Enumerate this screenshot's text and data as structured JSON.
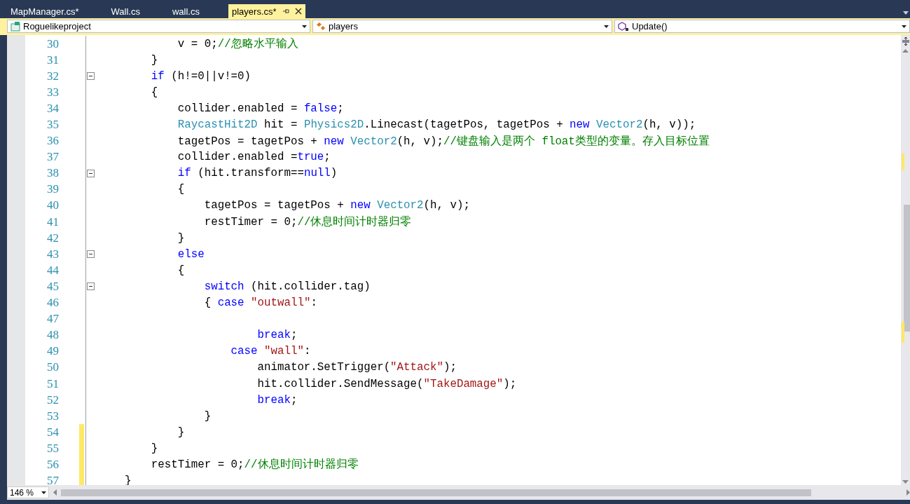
{
  "tabs": [
    {
      "label": "MapManager.cs*",
      "selected": false
    },
    {
      "label": "Wall.cs",
      "selected": false
    },
    {
      "label": "wall.cs",
      "selected": false
    },
    {
      "label": "players.cs*",
      "selected": true
    }
  ],
  "navigation_bar": {
    "project": "Roguelikeproject",
    "class": "players",
    "member": "Update()"
  },
  "code_lines": [
    {
      "number": "30",
      "collapsible": false,
      "modified": false,
      "tokens": [
        {
          "kind": "plain",
          "text": "            v = 0;"
        },
        {
          "kind": "comment",
          "text": "//忽略水平输入"
        }
      ]
    },
    {
      "number": "31",
      "collapsible": false,
      "modified": false,
      "tokens": [
        {
          "kind": "plain",
          "text": "        }"
        }
      ]
    },
    {
      "number": "32",
      "collapsible": true,
      "modified": false,
      "tokens": [
        {
          "kind": "keyword",
          "text": "        if"
        },
        {
          "kind": "plain",
          "text": " (h!=0||v!=0)"
        }
      ]
    },
    {
      "number": "33",
      "collapsible": false,
      "modified": false,
      "tokens": [
        {
          "kind": "plain",
          "text": "        {"
        }
      ]
    },
    {
      "number": "34",
      "collapsible": false,
      "modified": false,
      "tokens": [
        {
          "kind": "plain",
          "text": "            collider.enabled = "
        },
        {
          "kind": "keyword",
          "text": "false"
        },
        {
          "kind": "plain",
          "text": ";"
        }
      ]
    },
    {
      "number": "35",
      "collapsible": false,
      "modified": false,
      "tokens": [
        {
          "kind": "type",
          "text": "            RaycastHit2D"
        },
        {
          "kind": "plain",
          "text": " hit = "
        },
        {
          "kind": "type",
          "text": "Physics2D"
        },
        {
          "kind": "plain",
          "text": ".Linecast(tagetPos, tagetPos + "
        },
        {
          "kind": "keyword",
          "text": "new "
        },
        {
          "kind": "type",
          "text": "Vector2"
        },
        {
          "kind": "plain",
          "text": "(h, v));"
        }
      ]
    },
    {
      "number": "36",
      "collapsible": false,
      "modified": false,
      "tokens": [
        {
          "kind": "plain",
          "text": "            tagetPos = tagetPos + "
        },
        {
          "kind": "keyword",
          "text": "new "
        },
        {
          "kind": "type",
          "text": "Vector2"
        },
        {
          "kind": "plain",
          "text": "(h, v);"
        },
        {
          "kind": "comment",
          "text": "//键盘输入是两个 float类型的变量。存入目标位置"
        }
      ]
    },
    {
      "number": "37",
      "collapsible": false,
      "modified": false,
      "tokens": [
        {
          "kind": "plain",
          "text": "            collider.enabled ="
        },
        {
          "kind": "keyword",
          "text": "true"
        },
        {
          "kind": "plain",
          "text": ";"
        }
      ]
    },
    {
      "number": "38",
      "collapsible": true,
      "modified": false,
      "tokens": [
        {
          "kind": "keyword",
          "text": "            if"
        },
        {
          "kind": "plain",
          "text": " (hit.transform=="
        },
        {
          "kind": "keyword",
          "text": "null"
        },
        {
          "kind": "plain",
          "text": ")"
        }
      ]
    },
    {
      "number": "39",
      "collapsible": false,
      "modified": false,
      "tokens": [
        {
          "kind": "plain",
          "text": "            {"
        }
      ]
    },
    {
      "number": "40",
      "collapsible": false,
      "modified": false,
      "tokens": [
        {
          "kind": "plain",
          "text": "                tagetPos = tagetPos + "
        },
        {
          "kind": "keyword",
          "text": "new "
        },
        {
          "kind": "type",
          "text": "Vector2"
        },
        {
          "kind": "plain",
          "text": "(h, v);"
        }
      ]
    },
    {
      "number": "41",
      "collapsible": false,
      "modified": false,
      "tokens": [
        {
          "kind": "plain",
          "text": "                restTimer = 0;"
        },
        {
          "kind": "comment",
          "text": "//休息时间计时器归零"
        }
      ]
    },
    {
      "number": "42",
      "collapsible": false,
      "modified": false,
      "tokens": [
        {
          "kind": "plain",
          "text": "            }"
        }
      ]
    },
    {
      "number": "43",
      "collapsible": true,
      "modified": false,
      "tokens": [
        {
          "kind": "keyword",
          "text": "            else"
        }
      ]
    },
    {
      "number": "44",
      "collapsible": false,
      "modified": false,
      "tokens": [
        {
          "kind": "plain",
          "text": "            {"
        }
      ]
    },
    {
      "number": "45",
      "collapsible": true,
      "modified": false,
      "tokens": [
        {
          "kind": "keyword",
          "text": "                switch"
        },
        {
          "kind": "plain",
          "text": " (hit.collider.tag)"
        }
      ]
    },
    {
      "number": "46",
      "collapsible": false,
      "modified": false,
      "tokens": [
        {
          "kind": "plain",
          "text": "                { "
        },
        {
          "kind": "keyword",
          "text": "case "
        },
        {
          "kind": "string",
          "text": "\"outwall\""
        },
        {
          "kind": "plain",
          "text": ":"
        }
      ]
    },
    {
      "number": "47",
      "collapsible": false,
      "modified": false
    },
    {
      "number": "48",
      "collapsible": false,
      "modified": false,
      "tokens": [
        {
          "kind": "keyword",
          "text": "                        break"
        },
        {
          "kind": "plain",
          "text": ";"
        }
      ]
    },
    {
      "number": "49",
      "collapsible": false,
      "modified": false,
      "tokens": [
        {
          "kind": "keyword",
          "text": "                    case "
        },
        {
          "kind": "string",
          "text": "\"wall\""
        },
        {
          "kind": "plain",
          "text": ":"
        }
      ]
    },
    {
      "number": "50",
      "collapsible": false,
      "modified": false,
      "tokens": [
        {
          "kind": "plain",
          "text": "                        animator.SetTrigger("
        },
        {
          "kind": "string",
          "text": "\"Attack\""
        },
        {
          "kind": "plain",
          "text": ");"
        }
      ]
    },
    {
      "number": "51",
      "collapsible": false,
      "modified": false,
      "tokens": [
        {
          "kind": "plain",
          "text": "                        hit.collider.SendMessage("
        },
        {
          "kind": "string",
          "text": "\"TakeDamage\""
        },
        {
          "kind": "plain",
          "text": ");"
        }
      ]
    },
    {
      "number": "52",
      "collapsible": false,
      "modified": false,
      "tokens": [
        {
          "kind": "keyword",
          "text": "                        break"
        },
        {
          "kind": "plain",
          "text": ";"
        }
      ]
    },
    {
      "number": "53",
      "collapsible": false,
      "modified": false,
      "tokens": [
        {
          "kind": "plain",
          "text": "                }"
        }
      ]
    },
    {
      "number": "54",
      "collapsible": false,
      "modified": true,
      "tokens": [
        {
          "kind": "plain",
          "text": "            }"
        }
      ]
    },
    {
      "number": "55",
      "collapsible": false,
      "modified": true,
      "tokens": [
        {
          "kind": "plain",
          "text": "        }"
        }
      ]
    },
    {
      "number": "56",
      "collapsible": false,
      "modified": true,
      "tokens": [
        {
          "kind": "plain",
          "text": "        restTimer = 0;"
        },
        {
          "kind": "comment",
          "text": "//休息时间计时器归零"
        }
      ]
    },
    {
      "number": "57",
      "collapsible": false,
      "modified": true,
      "tokens": [
        {
          "kind": "plain",
          "text": "    }"
        }
      ]
    }
  ],
  "zoom": {
    "value": "146 %"
  }
}
